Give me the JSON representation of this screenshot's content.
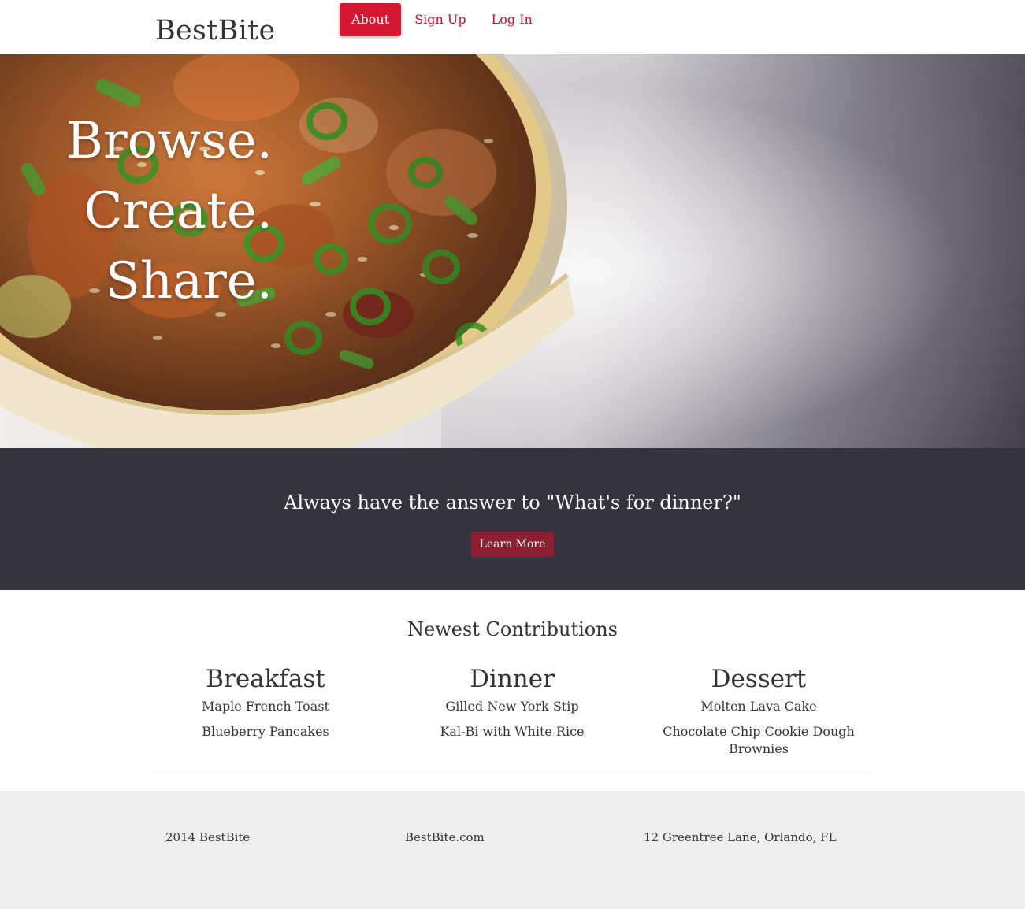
{
  "header": {
    "brand": "BestBite",
    "nav": [
      {
        "label": "About",
        "active": true
      },
      {
        "label": "Sign Up",
        "active": false
      },
      {
        "label": "Log In",
        "active": false
      }
    ]
  },
  "hero": {
    "lines": [
      "Browse.",
      "Create.",
      "Share."
    ],
    "image": "bowl-of-jambalaya-with-green-onions"
  },
  "band": {
    "title": "Always have the answer to \"What's for dinner?\"",
    "button_label": "Learn More"
  },
  "newest": {
    "title": "Newest Contributions",
    "columns": [
      {
        "heading": "Breakfast",
        "items": [
          "Maple French Toast",
          "Blueberry Pancakes"
        ]
      },
      {
        "heading": "Dinner",
        "items": [
          "Gilled New York Stip",
          "Kal-Bi with White Rice"
        ]
      },
      {
        "heading": "Dessert",
        "items": [
          "Molten Lava Cake",
          "Chocolate Chip Cookie Dough Brownies"
        ]
      }
    ]
  },
  "footer": {
    "copyright": "2014 BestBite",
    "site": "BestBite.com",
    "address": "12 Greentree Lane, Orlando, FL"
  },
  "colors": {
    "accent": "#d31932",
    "link": "#c7102b",
    "band_bg": "#35333f",
    "button_bg": "#8e1f33",
    "footer_bg": "#eeeeee"
  }
}
